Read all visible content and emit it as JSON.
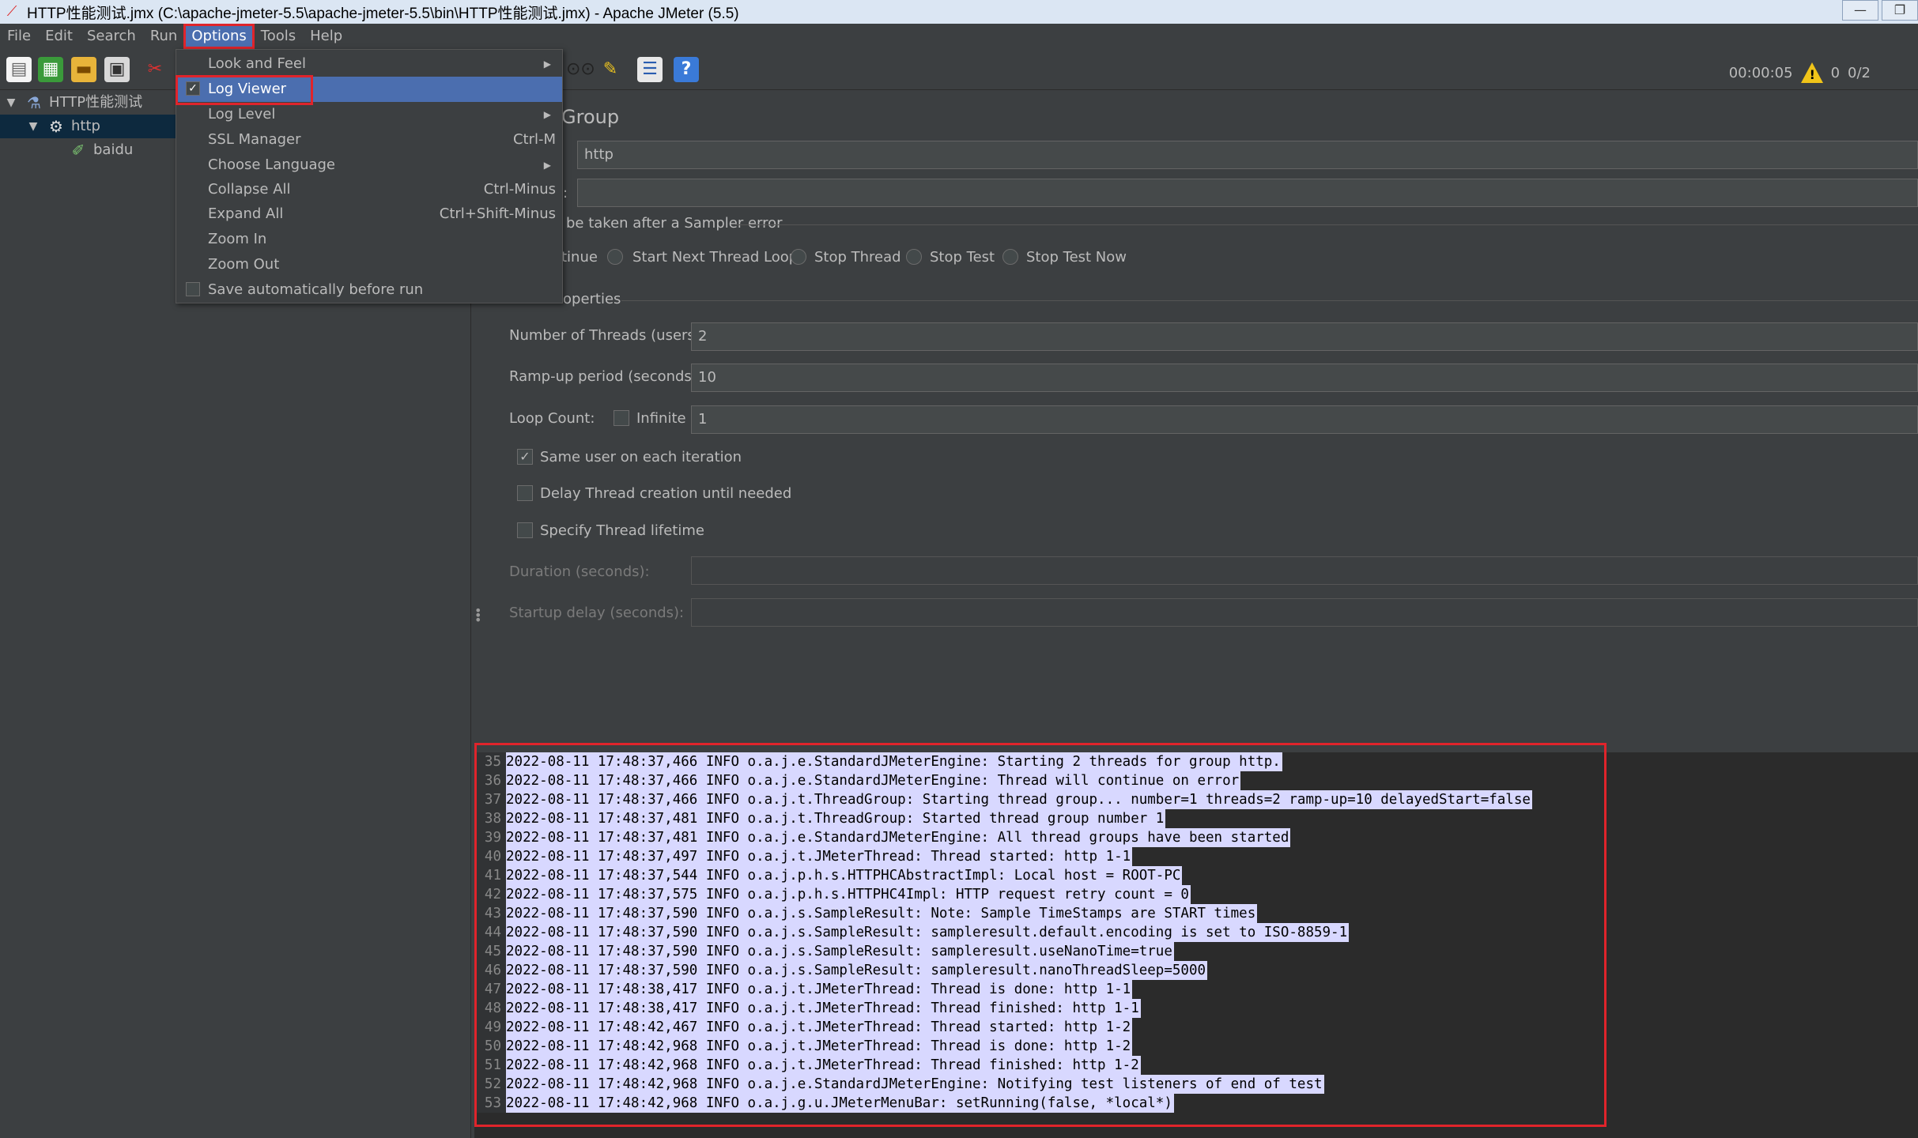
{
  "window": {
    "title": "HTTP性能测试.jmx (C:\\apache-jmeter-5.5\\apache-jmeter-5.5\\bin\\HTTP性能测试.jmx) - Apache JMeter (5.5)",
    "minimize": "—",
    "restore": "❐"
  },
  "menubar": {
    "file": "File",
    "edit": "Edit",
    "search": "Search",
    "run": "Run",
    "options": "Options",
    "tools": "Tools",
    "help": "Help"
  },
  "toolbar": {
    "timer": "00:00:05",
    "warning_count": "0",
    "threads": "0/2"
  },
  "tree": {
    "root": "HTTP性能测试",
    "thread_group": "http",
    "sampler": "baidu"
  },
  "options_menu": {
    "items": [
      {
        "label": "Look and Feel",
        "accel": "",
        "submenu": true
      },
      {
        "label": "Log Viewer",
        "accel": "",
        "checked": true
      },
      {
        "label": "Log Level",
        "accel": "",
        "submenu": true
      },
      {
        "label": "SSL Manager",
        "accel": "Ctrl-M"
      },
      {
        "label": "Choose Language",
        "accel": "",
        "submenu": true
      },
      {
        "label": "Collapse All",
        "accel": "Ctrl-Minus"
      },
      {
        "label": "Expand All",
        "accel": "Ctrl+Shift-Minus"
      },
      {
        "label": "Zoom In",
        "accel": ""
      },
      {
        "label": "Zoom Out",
        "accel": ""
      },
      {
        "label": "Save automatically before run",
        "accel": "",
        "checked": false
      }
    ]
  },
  "thread_group": {
    "heading": "Group",
    "name_value": "http",
    "comments_label": ":",
    "comments_value": "",
    "action_label": "be taken after a Sampler error",
    "actions": {
      "continue": "tinue",
      "next_loop": "Start Next Thread Loop",
      "stop_thread": "Stop Thread",
      "stop_test": "Stop Test",
      "stop_now": "Stop Test Now"
    },
    "properties_label": "operties",
    "threads_label": "Number of Threads (users):",
    "threads_value": "2",
    "rampup_label": "Ramp-up period (seconds):",
    "rampup_value": "10",
    "loop_label": "Loop Count:",
    "infinite_label": "Infinite",
    "loop_value": "1",
    "same_user_label": "Same user on each iteration",
    "delay_label": "Delay Thread creation until needed",
    "lifetime_label": "Specify Thread lifetime",
    "duration_label": "Duration (seconds):",
    "startup_label": "Startup delay (seconds):"
  },
  "log": {
    "lines": [
      {
        "n": "35",
        "text": "2022-08-11 17:48:37,466 INFO o.a.j.e.StandardJMeterEngine: Starting 2 threads for group http."
      },
      {
        "n": "36",
        "text": "2022-08-11 17:48:37,466 INFO o.a.j.e.StandardJMeterEngine: Thread will continue on error"
      },
      {
        "n": "37",
        "text": "2022-08-11 17:48:37,466 INFO o.a.j.t.ThreadGroup: Starting thread group... number=1 threads=2 ramp-up=10 delayedStart=false"
      },
      {
        "n": "38",
        "text": "2022-08-11 17:48:37,481 INFO o.a.j.t.ThreadGroup: Started thread group number 1"
      },
      {
        "n": "39",
        "text": "2022-08-11 17:48:37,481 INFO o.a.j.e.StandardJMeterEngine: All thread groups have been started"
      },
      {
        "n": "40",
        "text": "2022-08-11 17:48:37,497 INFO o.a.j.t.JMeterThread: Thread started: http 1-1"
      },
      {
        "n": "41",
        "text": "2022-08-11 17:48:37,544 INFO o.a.j.p.h.s.HTTPHCAbstractImpl: Local host = ROOT-PC"
      },
      {
        "n": "42",
        "text": "2022-08-11 17:48:37,575 INFO o.a.j.p.h.s.HTTPHC4Impl: HTTP request retry count = 0"
      },
      {
        "n": "43",
        "text": "2022-08-11 17:48:37,590 INFO o.a.j.s.SampleResult: Note: Sample TimeStamps are START times"
      },
      {
        "n": "44",
        "text": "2022-08-11 17:48:37,590 INFO o.a.j.s.SampleResult: sampleresult.default.encoding is set to ISO-8859-1"
      },
      {
        "n": "45",
        "text": "2022-08-11 17:48:37,590 INFO o.a.j.s.SampleResult: sampleresult.useNanoTime=true"
      },
      {
        "n": "46",
        "text": "2022-08-11 17:48:37,590 INFO o.a.j.s.SampleResult: sampleresult.nanoThreadSleep=5000"
      },
      {
        "n": "47",
        "text": "2022-08-11 17:48:38,417 INFO o.a.j.t.JMeterThread: Thread is done: http 1-1"
      },
      {
        "n": "48",
        "text": "2022-08-11 17:48:38,417 INFO o.a.j.t.JMeterThread: Thread finished: http 1-1"
      },
      {
        "n": "49",
        "text": "2022-08-11 17:48:42,467 INFO o.a.j.t.JMeterThread: Thread started: http 1-2"
      },
      {
        "n": "50",
        "text": "2022-08-11 17:48:42,968 INFO o.a.j.t.JMeterThread: Thread is done: http 1-2"
      },
      {
        "n": "51",
        "text": "2022-08-11 17:48:42,968 INFO o.a.j.t.JMeterThread: Thread finished: http 1-2"
      },
      {
        "n": "52",
        "text": "2022-08-11 17:48:42,968 INFO o.a.j.e.StandardJMeterEngine: Notifying test listeners of end of test"
      },
      {
        "n": "53",
        "text": "2022-08-11 17:48:42,968 INFO o.a.j.g.u.JMeterMenuBar: setRunning(false, *local*)"
      }
    ]
  },
  "colors": {
    "background": "#3c3f41",
    "highlight": "#4b6eaf",
    "annotation_red": "#e0242b",
    "log_selection": "#d8d8ff"
  }
}
